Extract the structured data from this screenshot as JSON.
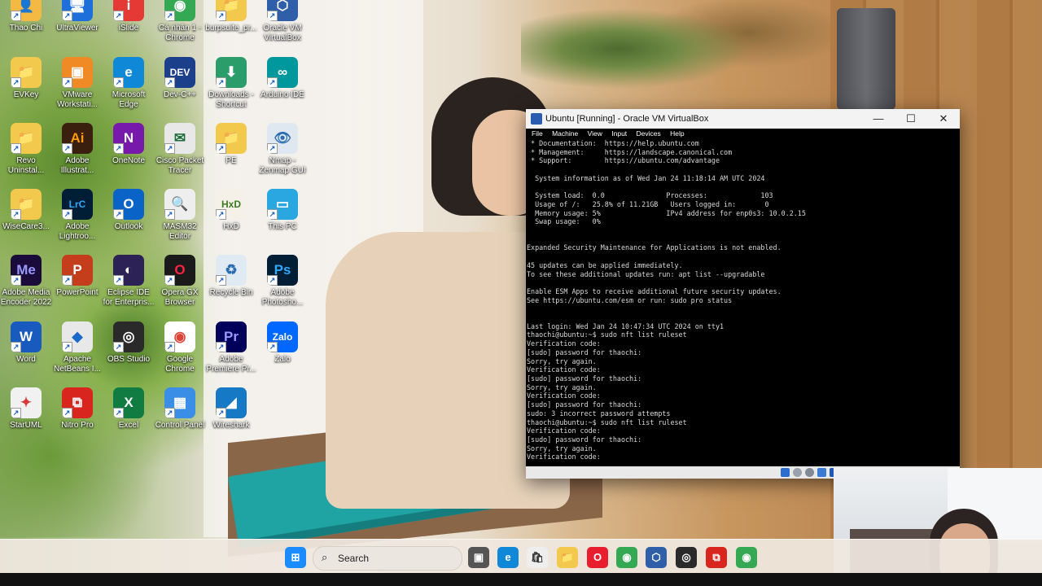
{
  "desktop": {
    "icons": [
      {
        "id": "thaochi",
        "label": "Thao Chi",
        "color": "#f4b942",
        "glyph": "👤",
        "icon": "user-folder-icon"
      },
      {
        "id": "ultraviewer",
        "label": "UltraViewer",
        "color": "#1e6fd9",
        "glyph": "🖥",
        "icon": "ultraviewer-icon"
      },
      {
        "id": "islide",
        "label": "iSlide",
        "color": "#e53935",
        "glyph": "i",
        "icon": "islide-icon"
      },
      {
        "id": "chrome-canhan",
        "label": "Cá nhân 1 -\nChrome",
        "color": "#34a853",
        "glyph": "◉",
        "icon": "chrome-icon"
      },
      {
        "id": "burpsuite",
        "label": "burpsuite_pr...",
        "color": "#f2c94c",
        "glyph": "📁",
        "icon": "folder-icon"
      },
      {
        "id": "virtualbox",
        "label": "Oracle VM\nVirtualBox",
        "color": "#2f5fa8",
        "glyph": "⬡",
        "icon": "virtualbox-icon"
      },
      {
        "id": "evkey",
        "label": "EVKey",
        "color": "#f2c94c",
        "glyph": "📁",
        "icon": "folder-icon"
      },
      {
        "id": "vmware",
        "label": "VMware\nWorkstati...",
        "color": "#f08a24",
        "glyph": "▣",
        "icon": "vmware-icon"
      },
      {
        "id": "edge",
        "label": "Microsoft\nEdge",
        "color": "#0f88d8",
        "glyph": "e",
        "icon": "edge-icon"
      },
      {
        "id": "devcpp",
        "label": "Dev-C++",
        "color": "#1c3f8c",
        "glyph": "DEV",
        "icon": "devcpp-icon"
      },
      {
        "id": "downloads",
        "label": "Downloads -\nShortcut",
        "color": "#2a9d6a",
        "glyph": "⬇",
        "icon": "downloads-folder-icon"
      },
      {
        "id": "arduino",
        "label": "Arduino IDE",
        "color": "#00979d",
        "glyph": "∞",
        "icon": "arduino-icon"
      },
      {
        "id": "revo",
        "label": "Revo\nUninstal...",
        "color": "#f2c94c",
        "glyph": "📁",
        "icon": "folder-icon"
      },
      {
        "id": "illustrator",
        "label": "Adobe\nIllustrat...",
        "color": "#3b1f0e",
        "glyph": "Ai",
        "icon": "illustrator-icon",
        "fg": "#ff9a00"
      },
      {
        "id": "onenote",
        "label": "OneNote",
        "color": "#7719aa",
        "glyph": "N",
        "icon": "onenote-icon"
      },
      {
        "id": "packettracer",
        "label": "Cisco Packet\nTracer",
        "color": "#e8e8e8",
        "glyph": "✉",
        "icon": "packet-tracer-icon",
        "fg": "#1b6b3a"
      },
      {
        "id": "pe",
        "label": "PE",
        "color": "#f2c94c",
        "glyph": "📁",
        "icon": "folder-icon"
      },
      {
        "id": "nmap",
        "label": "Nmap -\nZenmap GUI",
        "color": "#dfe8f0",
        "glyph": "👁",
        "icon": "nmap-icon",
        "fg": "#2b6cb0"
      },
      {
        "id": "wisecare",
        "label": "WiseCare3...",
        "color": "#f2c94c",
        "glyph": "📁",
        "icon": "folder-icon"
      },
      {
        "id": "lightroom",
        "label": "Adobe\nLightroo...",
        "color": "#001e36",
        "glyph": "LrC",
        "icon": "lightroom-icon",
        "fg": "#31a8ff"
      },
      {
        "id": "outlook",
        "label": "Outlook",
        "color": "#0a64c8",
        "glyph": "O",
        "icon": "outlook-icon"
      },
      {
        "id": "masm",
        "label": "MASM32\nEditor",
        "color": "#eeeeee",
        "glyph": "🔍",
        "icon": "masm-icon",
        "fg": "#333"
      },
      {
        "id": "hxd",
        "label": "HxD",
        "color": "#f5f1e8",
        "glyph": "HxD",
        "icon": "hxd-icon",
        "fg": "#3a7a20"
      },
      {
        "id": "thispc",
        "label": "This PC",
        "color": "#2aa7e0",
        "glyph": "▭",
        "icon": "this-pc-icon"
      },
      {
        "id": "mediaencoder",
        "label": "Adobe Media\nEncoder 2022",
        "color": "#1a0b3b",
        "glyph": "Me",
        "icon": "media-encoder-icon",
        "fg": "#9999ff"
      },
      {
        "id": "powerpoint",
        "label": "PowerPoint",
        "color": "#c43e1c",
        "glyph": "P",
        "icon": "powerpoint-icon"
      },
      {
        "id": "eclipse",
        "label": "Eclipse IDE\nfor Enterpris...",
        "color": "#2c2255",
        "glyph": "◐",
        "icon": "eclipse-icon"
      },
      {
        "id": "operagx",
        "label": "Opera GX\nBrowser",
        "color": "#1a1a1a",
        "glyph": "O",
        "icon": "opera-gx-icon",
        "fg": "#ff2244"
      },
      {
        "id": "recyclebin",
        "label": "Recycle Bin",
        "color": "#dfeaf3",
        "glyph": "♻",
        "icon": "recycle-bin-icon",
        "fg": "#2b6cb0"
      },
      {
        "id": "photoshop",
        "label": "Adobe\nPhotosho...",
        "color": "#001e36",
        "glyph": "Ps",
        "icon": "photoshop-icon",
        "fg": "#31a8ff"
      },
      {
        "id": "word",
        "label": "Word",
        "color": "#185abd",
        "glyph": "W",
        "icon": "word-icon"
      },
      {
        "id": "netbeans",
        "label": "Apache\nNetBeans I...",
        "color": "#e8e8e8",
        "glyph": "◆",
        "icon": "netbeans-icon",
        "fg": "#1b6ac9"
      },
      {
        "id": "obs",
        "label": "OBS Studio",
        "color": "#2a2a2a",
        "glyph": "◎",
        "icon": "obs-icon"
      },
      {
        "id": "chrome",
        "label": "Google\nChrome",
        "color": "#ffffff",
        "glyph": "◉",
        "icon": "chrome-icon",
        "fg": "#db4437"
      },
      {
        "id": "premiere",
        "label": "Adobe\nPremiere Pr...",
        "color": "#00005b",
        "glyph": "Pr",
        "icon": "premiere-icon",
        "fg": "#9999ff"
      },
      {
        "id": "zalo",
        "label": "Zalo",
        "color": "#0068ff",
        "glyph": "Zalo",
        "icon": "zalo-icon"
      },
      {
        "id": "staruml",
        "label": "StarUML",
        "color": "#f1f1f1",
        "glyph": "✦",
        "icon": "staruml-icon",
        "fg": "#d63a3a"
      },
      {
        "id": "nitro",
        "label": "Nitro Pro",
        "color": "#d8261f",
        "glyph": "⧉",
        "icon": "nitro-pro-icon"
      },
      {
        "id": "excel",
        "label": "Excel",
        "color": "#107c41",
        "glyph": "X",
        "icon": "excel-icon"
      },
      {
        "id": "controlpanel",
        "label": "Control Panel",
        "color": "#3a8ee6",
        "glyph": "▦",
        "icon": "control-panel-icon"
      },
      {
        "id": "wireshark",
        "label": "Wireshark",
        "color": "#1679c5",
        "glyph": "◢",
        "icon": "wireshark-icon"
      }
    ]
  },
  "vbox": {
    "title": "Ubuntu [Running] - Oracle VM VirtualBox",
    "menu": [
      "File",
      "Machine",
      "View",
      "Input",
      "Devices",
      "Help"
    ],
    "controls": {
      "minimize": "—",
      "maximize": "☐",
      "close": "✕"
    },
    "terminal_lines": [
      " * Documentation:  https://help.ubuntu.com",
      " * Management:     https://landscape.canonical.com",
      " * Support:        https://ubuntu.com/advantage",
      "",
      "  System information as of Wed Jan 24 11:18:14 AM UTC 2024",
      "",
      "  System load:  0.0               Processes:             103",
      "  Usage of /:   25.8% of 11.21GB   Users logged in:       0",
      "  Memory usage: 5%                IPv4 address for enp0s3: 10.0.2.15",
      "  Swap usage:   0%",
      "",
      "",
      "Expanded Security Maintenance for Applications is not enabled.",
      "",
      "45 updates can be applied immediately.",
      "To see these additional updates run: apt list --upgradable",
      "",
      "Enable ESM Apps to receive additional future security updates.",
      "See https://ubuntu.com/esm or run: sudo pro status",
      "",
      "",
      "Last login: Wed Jan 24 10:47:34 UTC 2024 on tty1",
      "thaochi@ubuntu:~$ sudo nft list ruleset",
      "Verification code:",
      "[sudo] password for thaochi:",
      "Sorry, try again.",
      "Verification code:",
      "[sudo] password for thaochi:",
      "Sorry, try again.",
      "Verification code:",
      "[sudo] password for thaochi:",
      "sudo: 3 incorrect password attempts",
      "thaochi@ubuntu:~$ sudo nft list ruleset",
      "Verification code:",
      "[sudo] password for thaochi:",
      "Sorry, try again.",
      "Verification code:"
    ]
  },
  "taskbar": {
    "search_label": "Search",
    "apps": [
      {
        "id": "start",
        "icon": "windows-start-icon",
        "glyph": "⊞",
        "color": "#1a8cff"
      },
      {
        "id": "taskview",
        "icon": "task-view-icon",
        "glyph": "▣",
        "color": "#555555"
      },
      {
        "id": "edge",
        "icon": "edge-icon",
        "glyph": "e",
        "color": "#0f88d8"
      },
      {
        "id": "store",
        "icon": "microsoft-store-icon",
        "glyph": "🛍",
        "color": "#eeeeee"
      },
      {
        "id": "explorer",
        "icon": "file-explorer-icon",
        "glyph": "📁",
        "color": "#f2c94c"
      },
      {
        "id": "opera",
        "icon": "opera-icon",
        "glyph": "O",
        "color": "#e81e2e"
      },
      {
        "id": "chrome",
        "icon": "chrome-icon",
        "glyph": "◉",
        "color": "#34a853"
      },
      {
        "id": "virtualbox",
        "icon": "virtualbox-icon",
        "glyph": "⬡",
        "color": "#2f5fa8"
      },
      {
        "id": "obs",
        "icon": "obs-icon",
        "glyph": "◎",
        "color": "#2a2a2a"
      },
      {
        "id": "nitro",
        "icon": "nitro-pro-icon",
        "glyph": "⧉",
        "color": "#d8261f"
      },
      {
        "id": "chrome2",
        "icon": "chrome-icon",
        "glyph": "◉",
        "color": "#34a853"
      }
    ]
  }
}
